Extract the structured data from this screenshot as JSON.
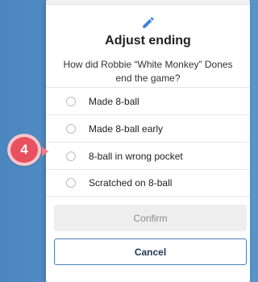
{
  "dialog": {
    "title": "Adjust ending",
    "question": "How did Robbie “White Monkey” Dones end the game?",
    "header_icon": "pencil-icon",
    "options": [
      {
        "label": "Made 8-ball",
        "selected": false
      },
      {
        "label": "Made 8-ball early",
        "selected": false
      },
      {
        "label": "8-ball in wrong pocket",
        "selected": false
      },
      {
        "label": "Scratched on 8-ball",
        "selected": false
      }
    ],
    "confirm_label": "Confirm",
    "cancel_label": "Cancel"
  },
  "step_badge": {
    "number": "4"
  },
  "colors": {
    "accent": "#3f86d8",
    "badge": "#e8515f",
    "cancel_border": "#4a7fb6",
    "backdrop": "#5a93c7"
  }
}
